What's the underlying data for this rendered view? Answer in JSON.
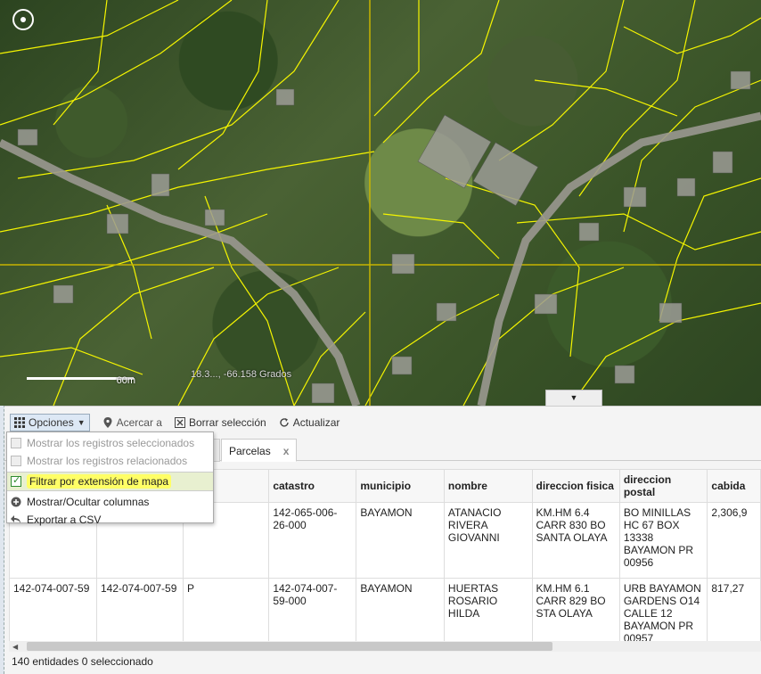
{
  "map": {
    "scale_label": "60m",
    "coords": "18.3..., -66.158 Grados"
  },
  "toolbar": {
    "options_label": "Opciones",
    "zoom_label": "Acercar a",
    "clear_label": "Borrar selección",
    "refresh_label": "Actualizar"
  },
  "menu": {
    "items": [
      {
        "label": "Mostrar los registros seleccionados",
        "enabled": false,
        "icon": "checkbox-icon"
      },
      {
        "label": "Mostrar los registros relacionados",
        "enabled": false,
        "icon": "checkbox-icon"
      },
      {
        "label": "Filtrar por extensión de mapa",
        "enabled": true,
        "checked": true,
        "icon": "checkbox-icon"
      },
      {
        "label": "Mostrar/Ocultar columnas",
        "enabled": true,
        "icon": "plus-circle-icon"
      },
      {
        "label": "Exportar a CSV",
        "enabled": true,
        "icon": "export-arrow-icon"
      }
    ]
  },
  "tab": {
    "label": "Parcelas",
    "close": "x"
  },
  "table": {
    "columns": [
      "",
      "",
      "",
      "catastro",
      "municipio",
      "nombre",
      "direccion fisica",
      "direccion postal",
      "cabida"
    ],
    "rows": [
      [
        "",
        "",
        "",
        "142-065-006-26-000",
        "BAYAMON",
        "ATANACIO RIVERA GIOVANNI",
        "KM.HM 6.4 CARR 830 BO SANTA OLAYA",
        "BO MINILLAS HC 67 BOX 13338 BAYAMON PR 00956",
        "2,306,9"
      ],
      [
        "142-074-007-59",
        "142-074-007-59",
        "P",
        "142-074-007-59-000",
        "BAYAMON",
        "HUERTAS ROSARIO HILDA",
        "KM.HM 6.1 CARR 829 BO STA OLAYA",
        "URB BAYAMON GARDENS O14 CALLE 12 BAYAMON PR 00957",
        "817,27"
      ]
    ]
  },
  "status": "140 entidades 0 seleccionado",
  "colors": {
    "parcel_line": "#f5f500",
    "highlight": "#ffff66"
  }
}
